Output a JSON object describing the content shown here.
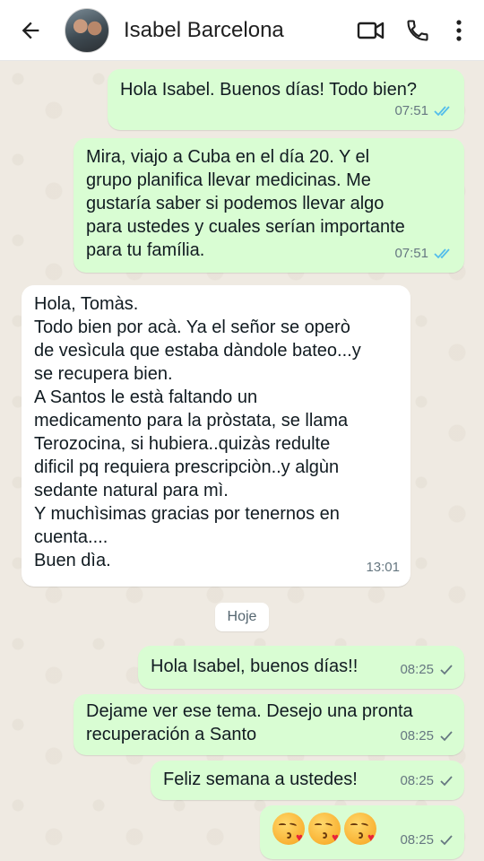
{
  "header": {
    "contact_name": "Isabel Barcelona"
  },
  "colors": {
    "outgoing_bubble": "#d9fdd3",
    "incoming_bubble": "#ffffff",
    "read_ticks": "#53bdeb",
    "sent_tick": "#667781"
  },
  "messages": [
    {
      "direction": "out",
      "text": "Hola Isabel. Buenos días! Todo bien?",
      "time": "07:51",
      "status": "read"
    },
    {
      "direction": "out",
      "text": "Mira, viajo a Cuba en el día 20. Y el\ngrupo planifica llevar medicinas. Me\ngustaría saber si podemos llevar algo\npara ustedes y cuales serían importante\npara tu família.",
      "time": "07:51",
      "status": "read"
    },
    {
      "direction": "in",
      "text": "Hola, Tomàs.\nTodo bien por acà. Ya el señor se operò\nde vesìcula que estaba dàndole bateo...y\nse recupera bien.\nA Santos le està faltando un\nmedicamento para la pròstata, se llama\nTerozocina, si hubiera..quizàs redulte\ndificil pq requiera prescripciòn..y algùn\nsedante natural para mì.\nY muchìsimas gracias por tenernos en\ncuenta....\nBuen dìa.",
      "time": "13:01"
    },
    {
      "direction": "out",
      "text": "Hola Isabel, buenos días!!",
      "time": "08:25",
      "status": "sent"
    },
    {
      "direction": "out",
      "text": "Dejame ver ese tema. Desejo una pronta\nrecuperación a Santo",
      "time": "08:25",
      "status": "sent"
    },
    {
      "direction": "out",
      "text": "Feliz semana a ustedes!",
      "time": "08:25",
      "status": "sent"
    },
    {
      "direction": "out",
      "emoji": [
        "kissing-heart",
        "kissing-heart",
        "kissing-heart"
      ],
      "time": "08:25",
      "status": "sent"
    }
  ],
  "day_divider": "Hoje",
  "icons": [
    "back-arrow-icon",
    "video-call-icon",
    "voice-call-icon",
    "more-options-icon",
    "double-check-icon",
    "single-check-icon",
    "kissing-heart-emoji-icon"
  ]
}
